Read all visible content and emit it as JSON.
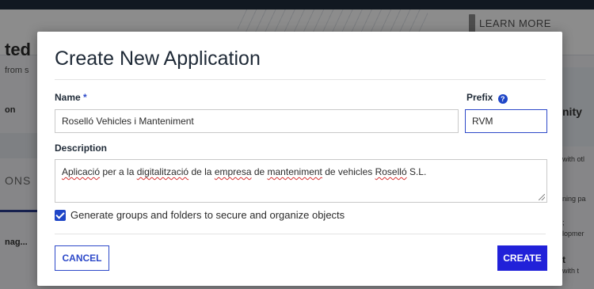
{
  "background": {
    "heading": "ted",
    "subtitle": "from s",
    "learn_more": "LEARN MORE",
    "column_label": "on",
    "tab_text": "ONS",
    "manage_text": "nag...",
    "right_heading": "nity",
    "right_lines": [
      "with otl",
      "ning pa",
      ";",
      "lopmer",
      "t",
      "with t"
    ]
  },
  "modal": {
    "title": "Create New Application",
    "name_label": "Name",
    "required_mark": "*",
    "name_value": "Roselló Vehicles i Manteniment",
    "prefix_label": "Prefix",
    "prefix_value": "RVM",
    "description_label": "Description",
    "description_segments": [
      {
        "text": "Aplicació",
        "misspelled": true
      },
      {
        "text": " per a la ",
        "misspelled": false
      },
      {
        "text": "digitalització",
        "misspelled": true
      },
      {
        "text": " de la ",
        "misspelled": false
      },
      {
        "text": "empresa",
        "misspelled": true
      },
      {
        "text": " de ",
        "misspelled": false
      },
      {
        "text": "manteniment",
        "misspelled": true
      },
      {
        "text": " de vehicles ",
        "misspelled": false
      },
      {
        "text": "Roselló",
        "misspelled": true
      },
      {
        "text": " S.L.",
        "misspelled": false
      }
    ],
    "checkbox_label": "Generate groups and folders to secure and organize objects",
    "checkbox_checked": true,
    "cancel_label": "CANCEL",
    "create_label": "CREATE"
  },
  "colors": {
    "accent": "#2d49c9",
    "create_button": "#2121d9",
    "spell_underline": "#d83030"
  },
  "icons": {
    "prefix_help": "question-circle-icon",
    "checkbox": "checkmark-icon",
    "textarea_resize": "resize-handle-icon"
  }
}
